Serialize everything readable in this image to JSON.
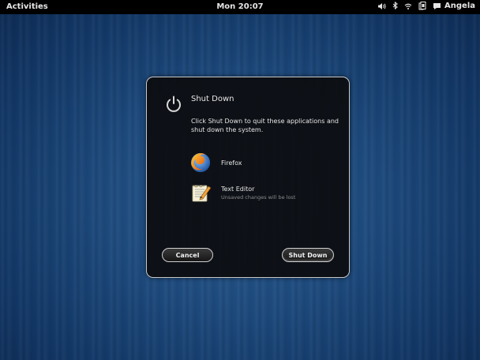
{
  "topbar": {
    "activities": "Activities",
    "clock": "Mon 20:07",
    "user": "Angela",
    "tray_icons": [
      "volume-icon",
      "bluetooth-icon",
      "wifi-icon",
      "accessibility-icon",
      "chat-icon"
    ]
  },
  "dialog": {
    "title": "Shut Down",
    "description": "Click Shut Down to quit these applications and shut down the system.",
    "apps": [
      {
        "name": "Firefox",
        "icon": "firefox-icon"
      },
      {
        "name": "Text Editor",
        "subtitle": "Unsaved changes will be lost",
        "icon": "text-editor-icon"
      }
    ],
    "buttons": {
      "cancel": "Cancel",
      "shutdown": "Shut Down"
    }
  },
  "colors": {
    "topbar_bg": "#000000",
    "dialog_bg": "#0c0c0e",
    "dialog_border": "#c9c9c9",
    "text": "#e6e6e6",
    "muted_text": "#8c8c8c",
    "wallpaper": "#1d4a7d"
  }
}
